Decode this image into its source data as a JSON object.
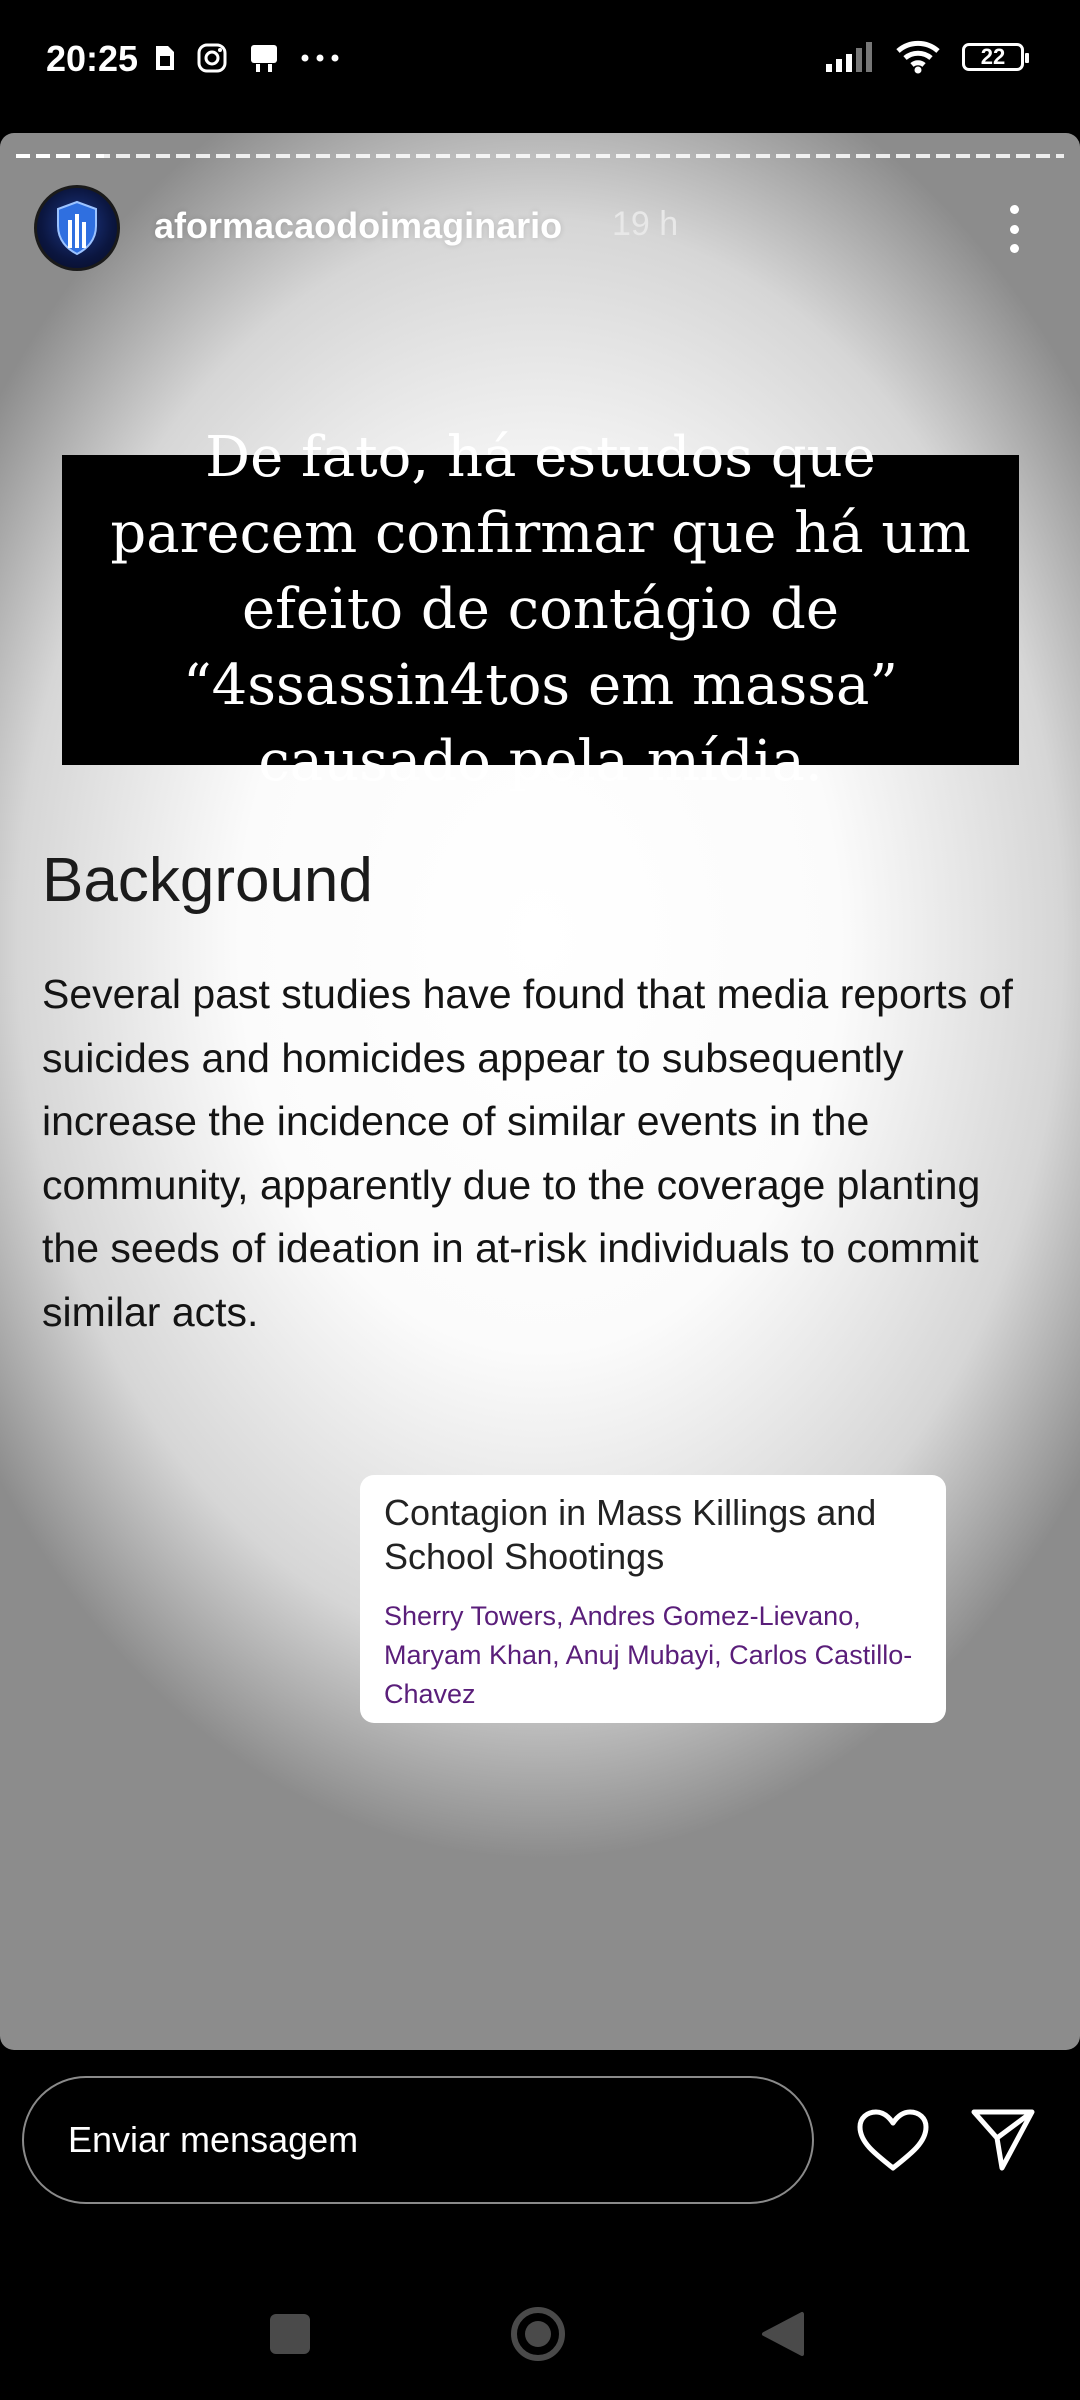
{
  "status_bar": {
    "time": "20:25",
    "battery": "22",
    "left_icons": [
      "sim-icon",
      "instagram-icon",
      "notification-icon",
      "more-dots-icon"
    ],
    "right_icons": [
      "signal-icon",
      "wifi-icon",
      "battery-icon"
    ]
  },
  "story": {
    "username": "aformacaodoimaginario",
    "time_ago": "19 h",
    "banner_text": "De fato, há estudos que parecem confirmar que há um efeito de contágio de “4ssassin4tos em massa” causado pela mídia.",
    "heading": "Background",
    "paragraph": "Several past studies have found that media reports of suicides and homicides appear to subsequently increase the incidence of similar events in the community, apparently due to the coverage planting the seeds of ideation in at-risk individuals to commit similar acts.",
    "article": {
      "title": "Contagion in Mass Killings and School Shootings",
      "authors": "Sherry Towers, Andres Gomez-Lievano, Maryam Khan, Anuj Mubayi, Carlos Castillo-Chavez"
    }
  },
  "reply_bar": {
    "placeholder": "Enviar mensagem",
    "icons": [
      "heart-icon",
      "send-icon"
    ]
  },
  "nav_bar": {
    "icons": [
      "recents-icon",
      "home-icon",
      "back-icon"
    ]
  },
  "colors": {
    "author_link": "#5a1e7a",
    "banner_bg": "#000000"
  }
}
